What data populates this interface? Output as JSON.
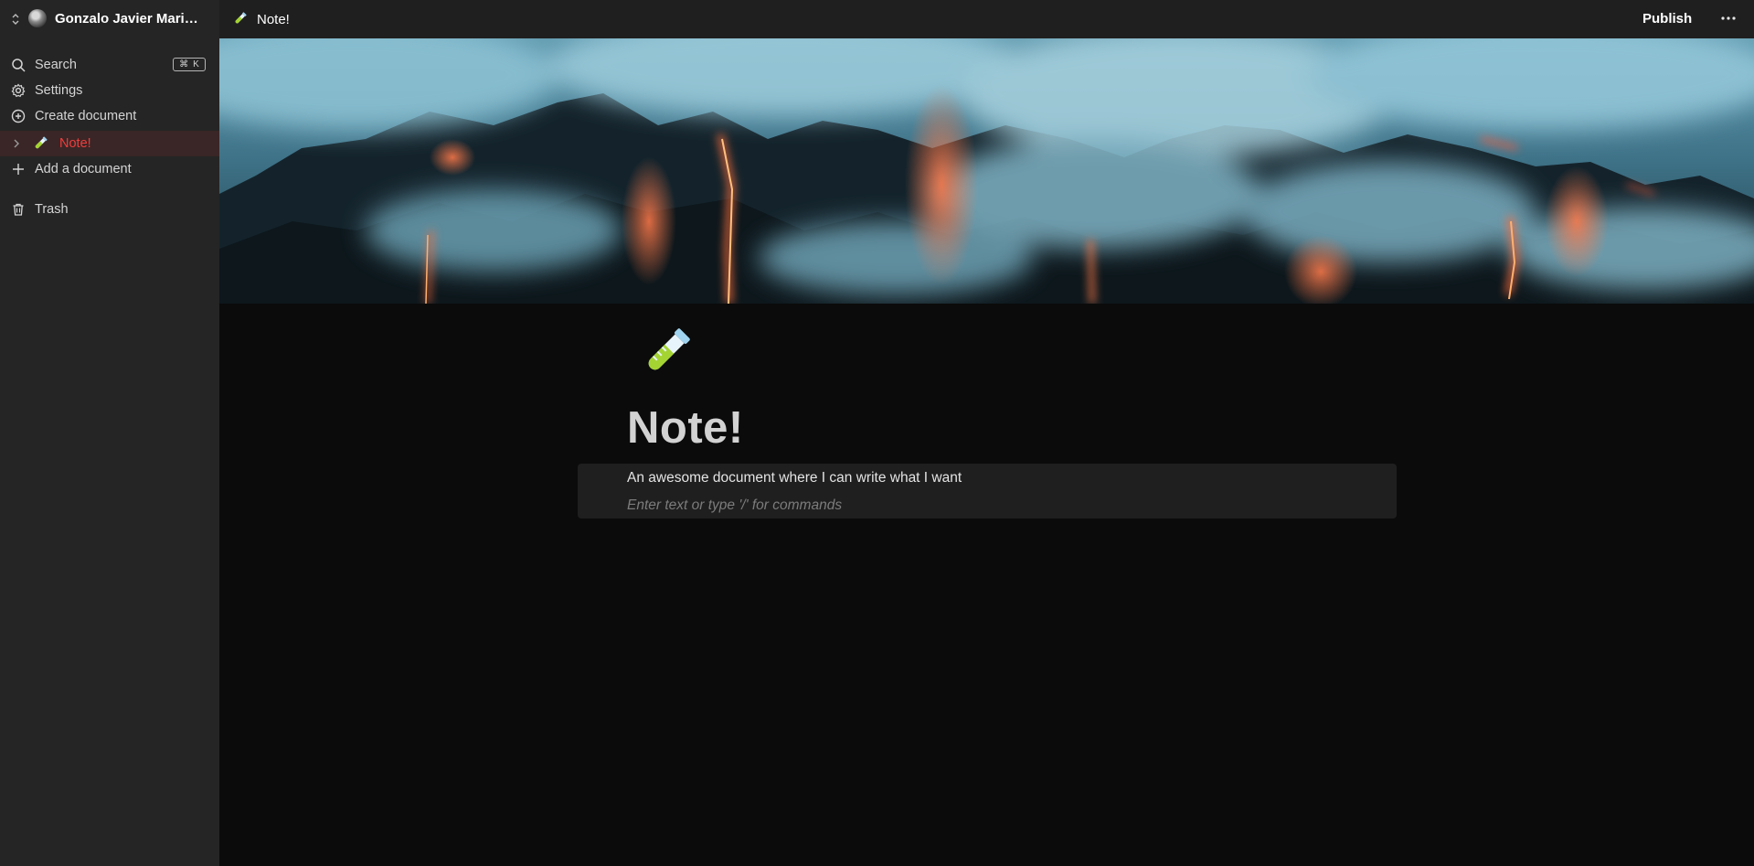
{
  "sidebar": {
    "workspace_name": "Gonzalo Javier Marin...",
    "nav": [
      {
        "label": "Search",
        "icon": "search-icon",
        "shortcut": {
          "symbol": "⌘",
          "key": "K"
        }
      },
      {
        "label": "Settings",
        "icon": "gear-icon"
      },
      {
        "label": "Create document",
        "icon": "plus-circle-icon"
      }
    ],
    "documents": [
      {
        "label": "Note!",
        "emoji": "test-tube-icon",
        "active": true,
        "active_color": "#ef3d3d"
      }
    ],
    "add_document_label": "Add a document",
    "trash_label": "Trash"
  },
  "header": {
    "breadcrumb_title": "Note!",
    "breadcrumb_icon": "test-tube-icon",
    "publish_label": "Publish",
    "more_icon": "more-horizontal-icon"
  },
  "document": {
    "cover_image": "lava-ocean-steam-cover",
    "icon": "test-tube-icon",
    "title": "Note!",
    "body_text": "An awesome document where I can write what I want",
    "placeholder": "Enter text or type '/' for commands"
  },
  "colors": {
    "sidebar_bg": "#252525",
    "topbar_bg": "#1f1f1f",
    "page_bg": "#0b0b0b",
    "active_text": "#ef3d3d"
  }
}
